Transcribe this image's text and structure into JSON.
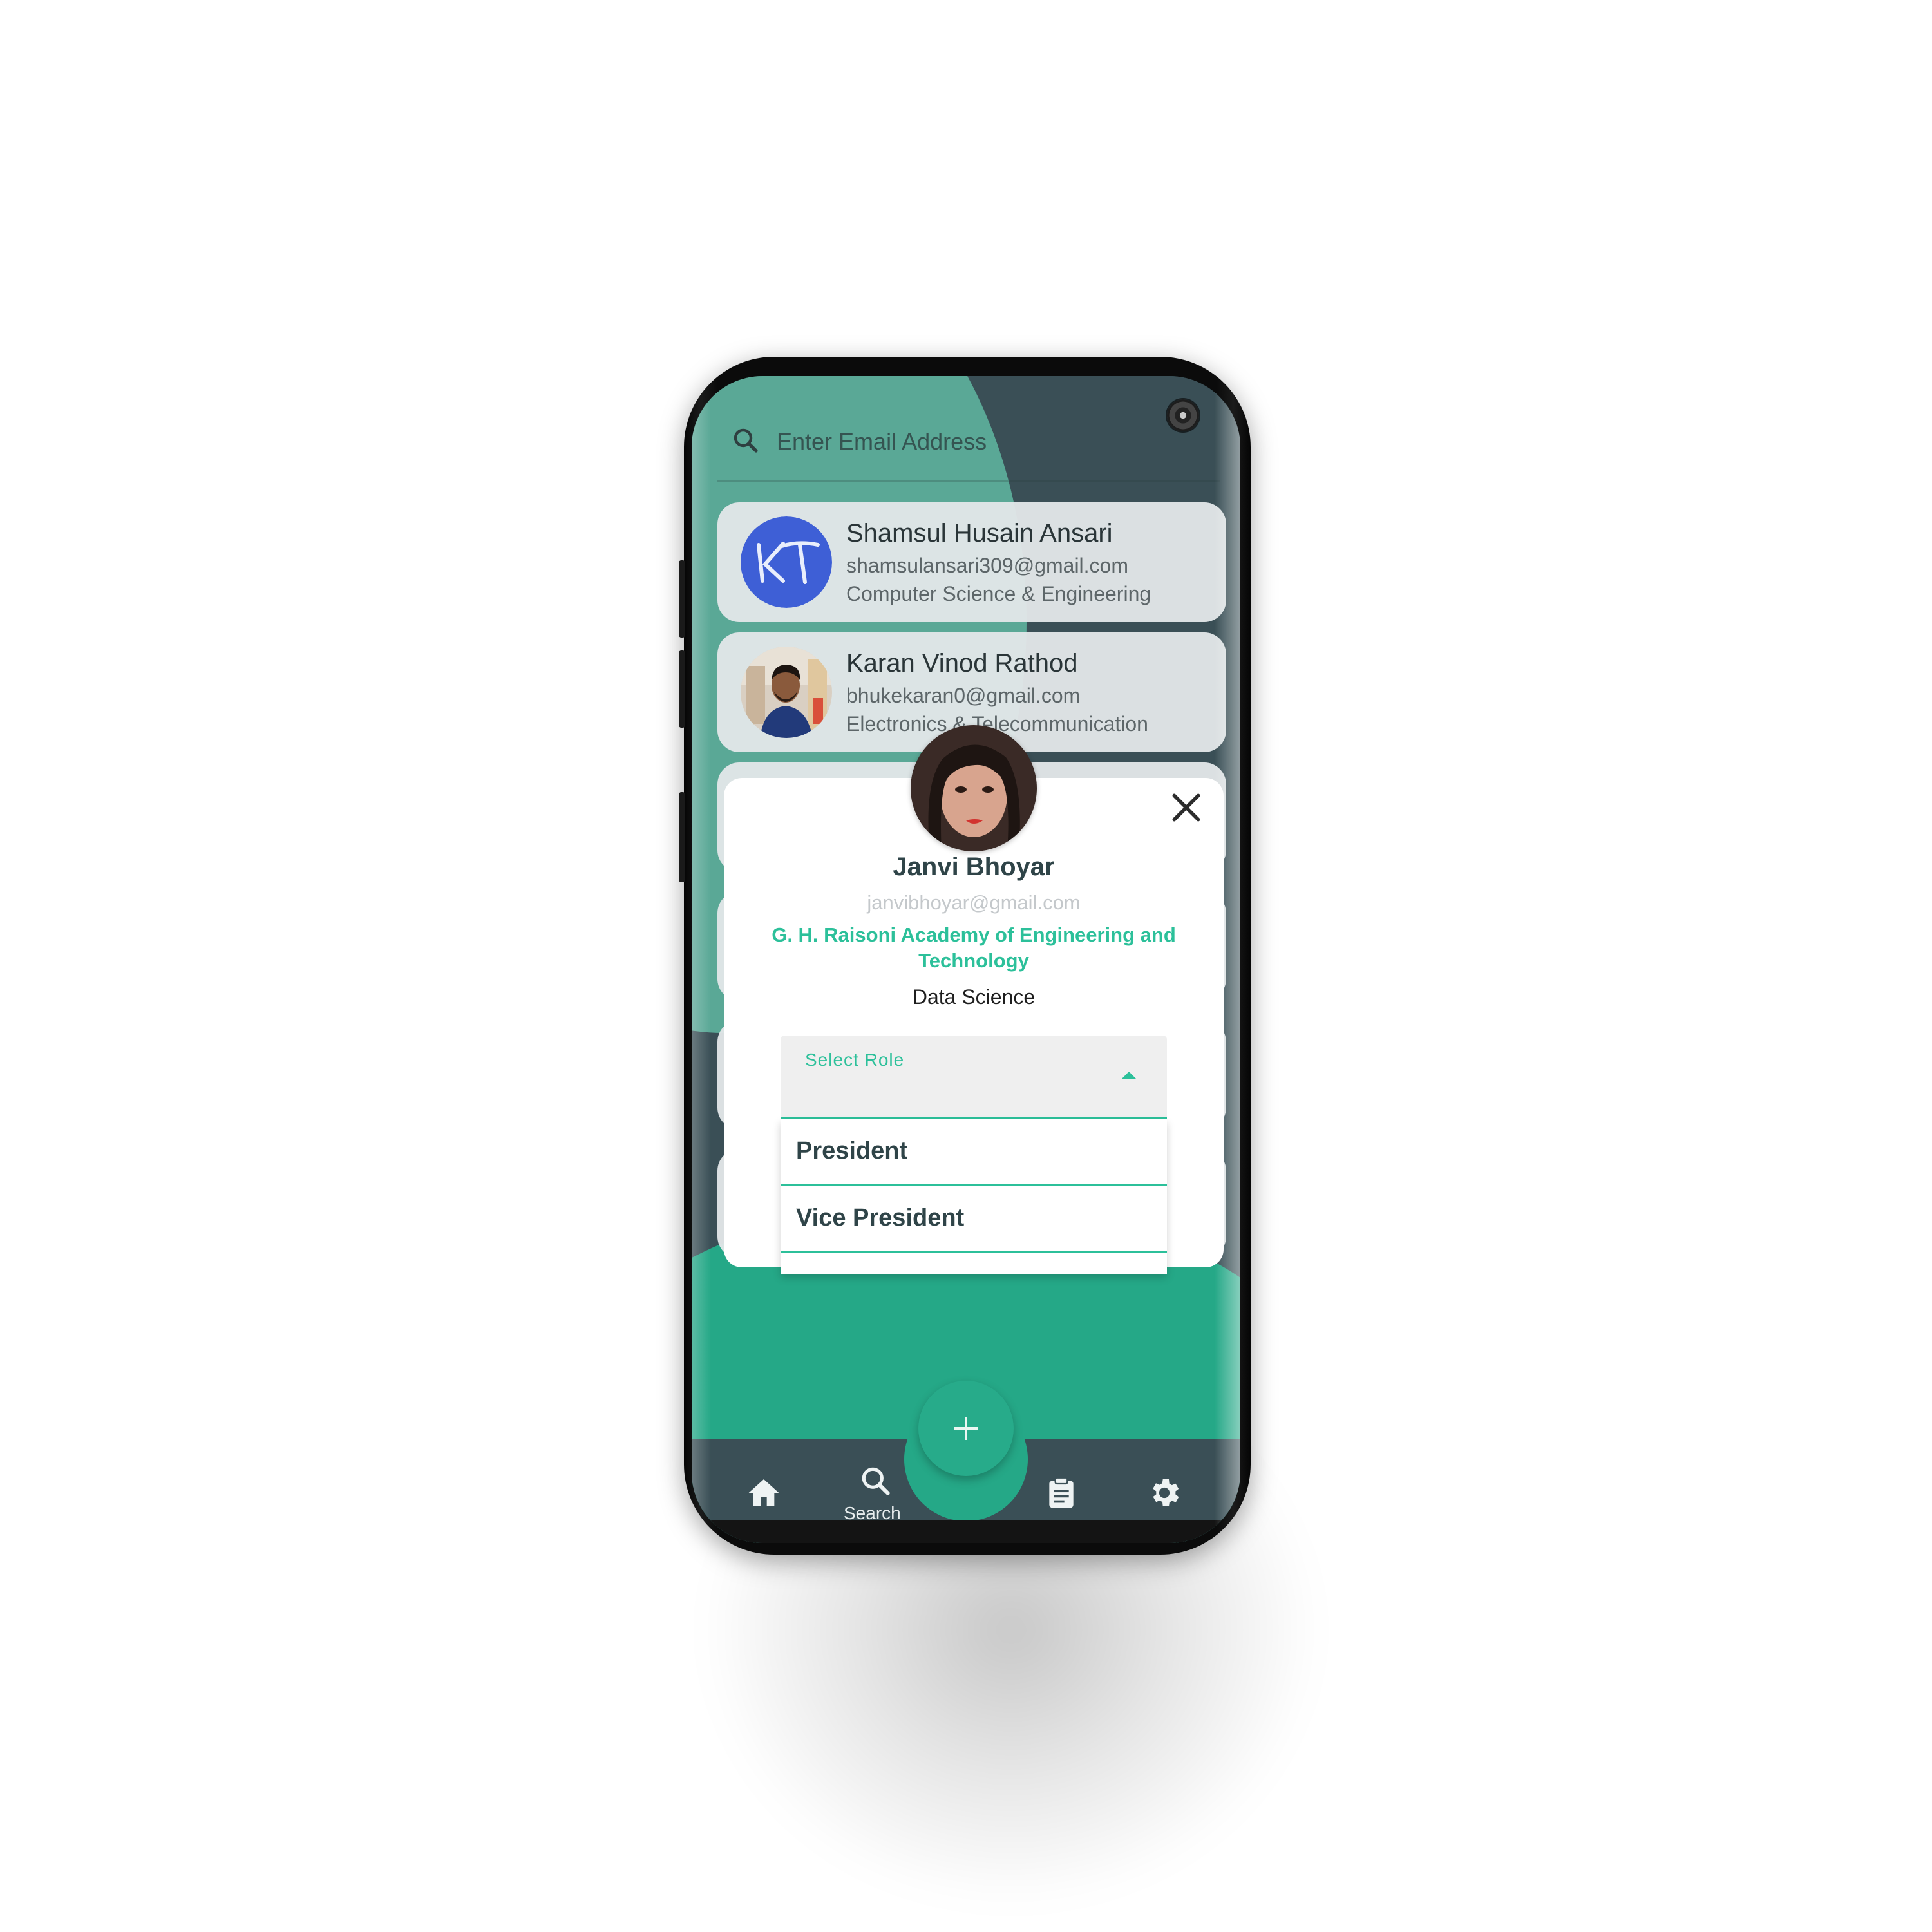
{
  "search": {
    "placeholder": "Enter Email Address"
  },
  "users": [
    {
      "name": "Shamsul Husain Ansari",
      "email": "shamsulansari309@gmail.com",
      "department": "Computer Science & Engineering",
      "avatar": "kt-logo"
    },
    {
      "name": "Karan Vinod Rathod",
      "email": "bhukekaran0@gmail.com",
      "department": "Electronics & Telecommunication",
      "avatar": "photo"
    }
  ],
  "modal": {
    "name": "Janvi Bhoyar",
    "email": "janvibhoyar@gmail.com",
    "college": "G. H. Raisoni Academy of Engineering and Technology",
    "branch": "Data Science",
    "role_label": "Select Role",
    "role_options": [
      "President",
      "Vice President"
    ]
  },
  "nav": {
    "items": [
      {
        "icon": "home-icon",
        "label": ""
      },
      {
        "icon": "search-icon",
        "label": "Search"
      },
      {
        "icon": "clipboard-icon",
        "label": ""
      },
      {
        "icon": "gear-icon",
        "label": ""
      }
    ],
    "fab_icon": "plus-icon"
  },
  "colors": {
    "accent": "#2cc09a",
    "dark": "#3a4f56",
    "green": "#25a887"
  }
}
